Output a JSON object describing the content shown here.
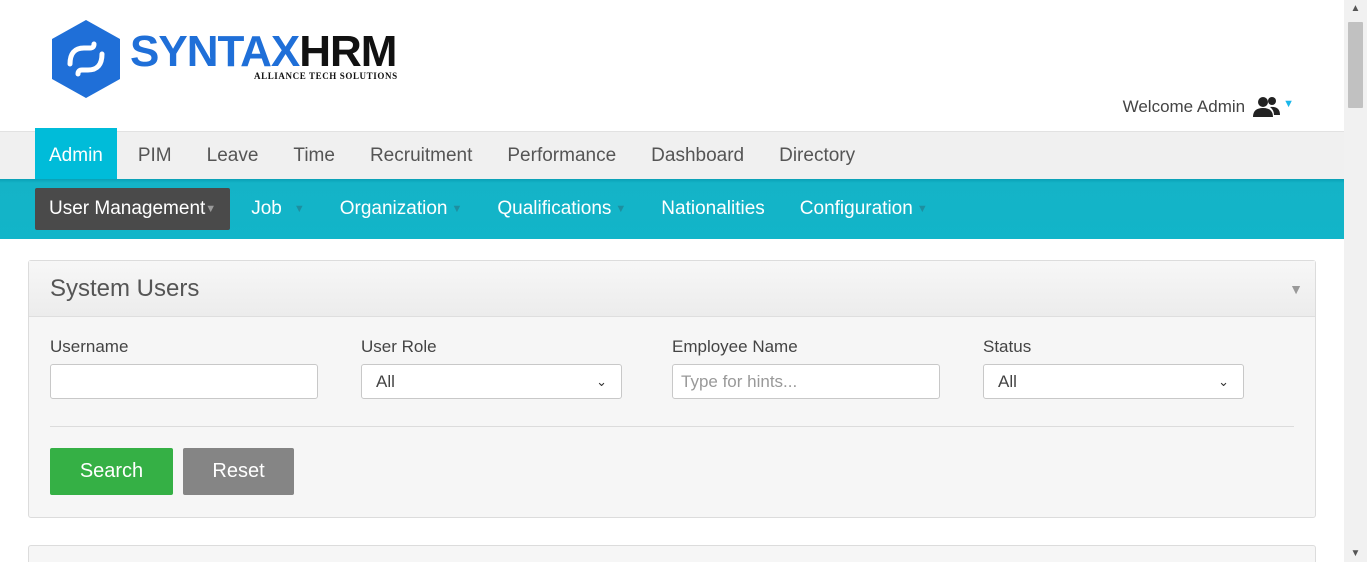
{
  "logo": {
    "brand_part1": "SYNTAX",
    "brand_part2": "HRM",
    "tagline": "ALLIANCE TECH SOLUTIONS",
    "colors": {
      "hex": "#1f6fd8",
      "text_dark": "#111111"
    }
  },
  "header": {
    "welcome_text": "Welcome Admin",
    "user_icon": "users-icon",
    "dropdown_icon": "caret-down-icon"
  },
  "main_menu": {
    "items": [
      {
        "label": "Admin",
        "active": true
      },
      {
        "label": "PIM"
      },
      {
        "label": "Leave"
      },
      {
        "label": "Time"
      },
      {
        "label": "Recruitment"
      },
      {
        "label": "Performance"
      },
      {
        "label": "Dashboard"
      },
      {
        "label": "Directory"
      }
    ]
  },
  "sub_menu": {
    "items": [
      {
        "label": "User Management",
        "dropdown": true,
        "active": true
      },
      {
        "label": "Job",
        "dropdown": true
      },
      {
        "label": "Organization",
        "dropdown": true
      },
      {
        "label": "Qualifications",
        "dropdown": true
      },
      {
        "label": "Nationalities",
        "dropdown": false
      },
      {
        "label": "Configuration",
        "dropdown": true
      }
    ]
  },
  "panel": {
    "title": "System Users",
    "fields": {
      "username": {
        "label": "Username",
        "value": ""
      },
      "user_role": {
        "label": "User Role",
        "value": "All"
      },
      "employee_name": {
        "label": "Employee Name",
        "placeholder": "Type for hints..."
      },
      "status": {
        "label": "Status",
        "value": "All"
      }
    },
    "buttons": {
      "search": "Search",
      "reset": "Reset"
    }
  },
  "colors": {
    "accent": "#00bcd9",
    "submenu_bg": "#12b5c9",
    "submenu_active": "#4a4a4a",
    "search_button": "#35b045",
    "reset_button": "#858585"
  }
}
